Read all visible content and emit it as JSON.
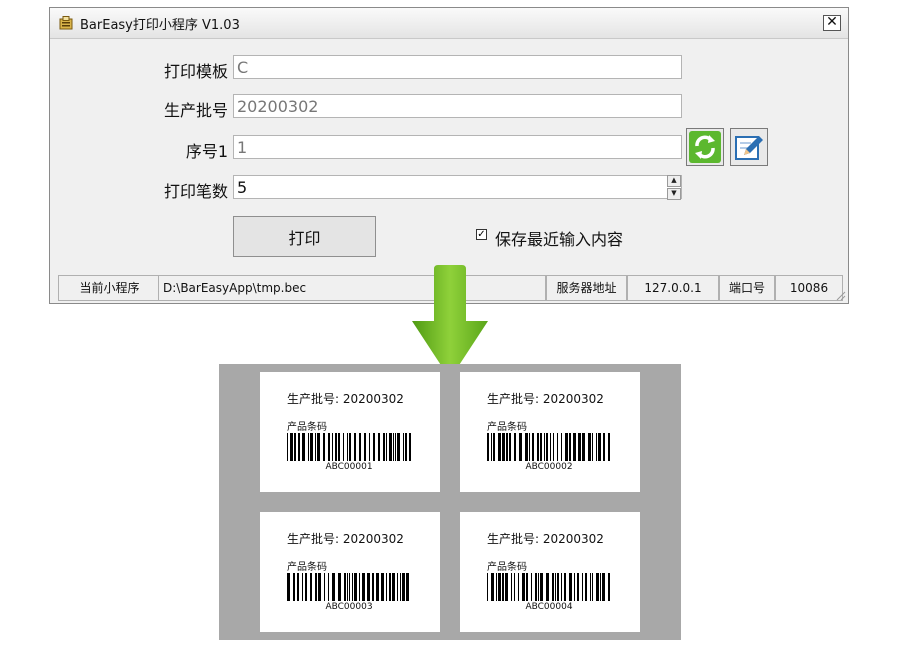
{
  "window": {
    "title": "BarEasy打印小程序 V1.03",
    "close_glyph": "✕"
  },
  "form": {
    "template_label": "打印模板",
    "template_value": "C",
    "batch_label": "生产批号",
    "batch_value": "20200302",
    "serial_label": "序号1",
    "serial_value": "1",
    "count_label": "打印笔数",
    "count_value": "5",
    "print_button": "打印",
    "remember_checked": true,
    "remember_label": "保存最近输入内容"
  },
  "icons": {
    "refresh": "refresh-icon",
    "edit": "edit-icon",
    "app": "app-icon",
    "arrow": "down-arrow-icon"
  },
  "statusbar": {
    "current_app_label": "当前小程序",
    "current_app_path": "D:\\BarEasyApp\\tmp.bec",
    "server_label": "服务器地址",
    "server_value": "127.0.0.1",
    "port_label": "端口号",
    "port_value": "10086"
  },
  "preview": {
    "labels": [
      {
        "batch_text": "生产批号: 20200302",
        "barcode_title": "产品条码",
        "code": "ABC00001"
      },
      {
        "batch_text": "生产批号: 20200302",
        "barcode_title": "产品条码",
        "code": "ABC00002"
      },
      {
        "batch_text": "生产批号: 20200302",
        "barcode_title": "产品条码",
        "code": "ABC00003"
      },
      {
        "batch_text": "生产批号: 20200302",
        "barcode_title": "产品条码",
        "code": "ABC00004"
      }
    ]
  },
  "colors": {
    "arrow_green": "#6bb51f",
    "refresh_green": "#4aa52a",
    "edit_blue": "#2b6fb3",
    "preview_bg": "#a8a8a8"
  }
}
